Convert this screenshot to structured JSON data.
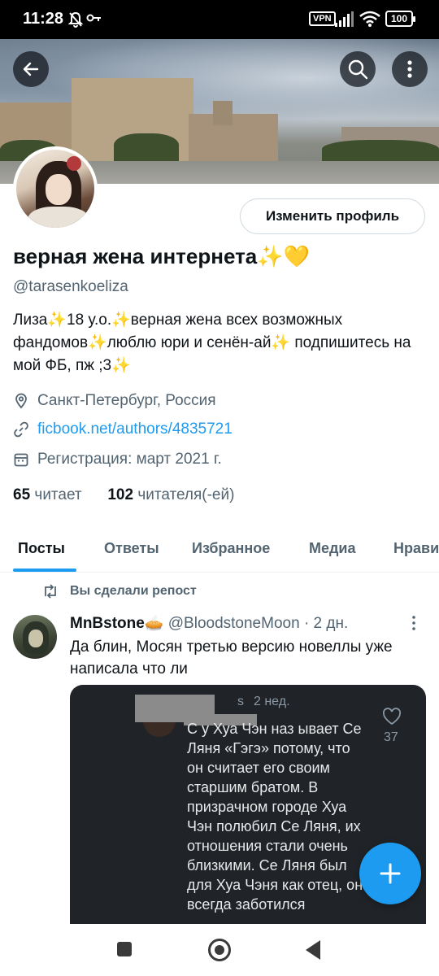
{
  "status_bar": {
    "time": "11:28",
    "vpn": "VPN",
    "battery": "100"
  },
  "profile": {
    "edit_button": "Изменить профиль",
    "name": "верная жена интернета✨💛",
    "handle": "@tarasenkoeliza",
    "bio": "Лиза✨18 у.о.✨верная жена всех возможных фандомов✨люблю юри и сенён-ай✨ подпишитесь на мой ФБ, пж ;3✨",
    "location": "Санкт-Петербург, Россия",
    "link": "ficbook.net/authors/4835721",
    "joined": "Регистрация: март 2021 г.",
    "following_count": "65",
    "following_label": "читает",
    "followers_count": "102",
    "followers_label": "читателя(-ей)"
  },
  "tabs": [
    "Посты",
    "Ответы",
    "Избранное",
    "Медиа",
    "Нрави"
  ],
  "active_tab": "Посты",
  "post": {
    "repost_label": "Вы сделали репост",
    "author_name": "MnBstone🥧",
    "author_handle": "@BloodstoneMoon",
    "time": "· 2 дн.",
    "text": "Да блин, Мосян третью версию новеллы уже написала что ли",
    "quote": {
      "author_tail": "s",
      "time": "2 нед.",
      "text": "С      у Хуа Чэн наз ывает Се Ляня «Гэгэ» потому, что он считает его своим старшим братом. В призрачном городе Хуа Чэн полюбил Се Ляня, их отношения стали очень близкими. Се Ляня был для Хуа Чэня как отец, он всегда заботился",
      "likes": "37"
    }
  },
  "colors": {
    "accent": "#1d9bf0",
    "secondary_text": "#536471",
    "quote_bg": "#202327"
  },
  "icons": {
    "header": [
      "back-arrow-icon",
      "search-icon",
      "more-vertical-icon"
    ],
    "meta": [
      "location-icon",
      "link-icon",
      "calendar-icon"
    ],
    "fab": "plus-icon",
    "nav": [
      "recents-icon",
      "home-icon",
      "back-icon"
    ]
  }
}
